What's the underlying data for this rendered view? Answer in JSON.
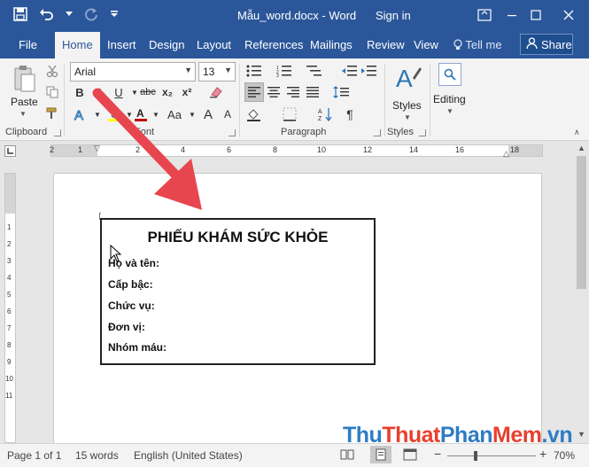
{
  "titlebar": {
    "title": "Mẫu_word.docx - Word",
    "signin": "Sign in"
  },
  "tabs": [
    "File",
    "Home",
    "Insert",
    "Design",
    "Layout",
    "References",
    "Mailings",
    "Review",
    "View"
  ],
  "tell_me": "Tell me",
  "share": "Share",
  "ribbon": {
    "clipboard": {
      "paste_label": "Paste",
      "group_label": "Clipboard"
    },
    "font": {
      "font_name": "Arial",
      "font_size": "13",
      "group_label": "Font",
      "bold": "B",
      "italic": "I",
      "underline": "U",
      "strike": "abc",
      "subscript": "x₂",
      "superscript": "x²",
      "change_case": "Aa",
      "grow": "A",
      "shrink": "A"
    },
    "paragraph": {
      "group_label": "Paragraph",
      "pilcrow": "¶"
    },
    "styles": {
      "label": "Styles",
      "group_label": "Styles"
    },
    "editing": {
      "label": "Editing"
    }
  },
  "ruler": {
    "h_labels": [
      "2",
      "1",
      "2",
      "4",
      "6",
      "8",
      "10",
      "12",
      "14",
      "16",
      "18"
    ],
    "v_labels": [
      "1",
      "2",
      "3",
      "4",
      "5",
      "6",
      "7",
      "8",
      "9",
      "10",
      "11"
    ]
  },
  "document": {
    "title": "PHIẾU KHÁM SỨC KHỎE",
    "fields": [
      "Họ và tên:",
      "Cấp bậc:",
      "Chức vụ:",
      "Đơn vị:",
      "Nhóm máu:"
    ]
  },
  "status": {
    "page": "Page 1 of 1",
    "words": "15 words",
    "language": "English (United States)",
    "zoom": "70%"
  },
  "watermark": {
    "parts": [
      "Thu",
      "Thuat",
      "Phan",
      "Mem",
      ".vn"
    ],
    "colors": [
      "#2e7cc4",
      "#e8402f",
      "#2e7cc4",
      "#e8402f",
      "#2e7cc4"
    ]
  },
  "colors": {
    "brand": "#2b579a",
    "arrow": "#e8464f",
    "font_color_bar": "#c00000"
  }
}
